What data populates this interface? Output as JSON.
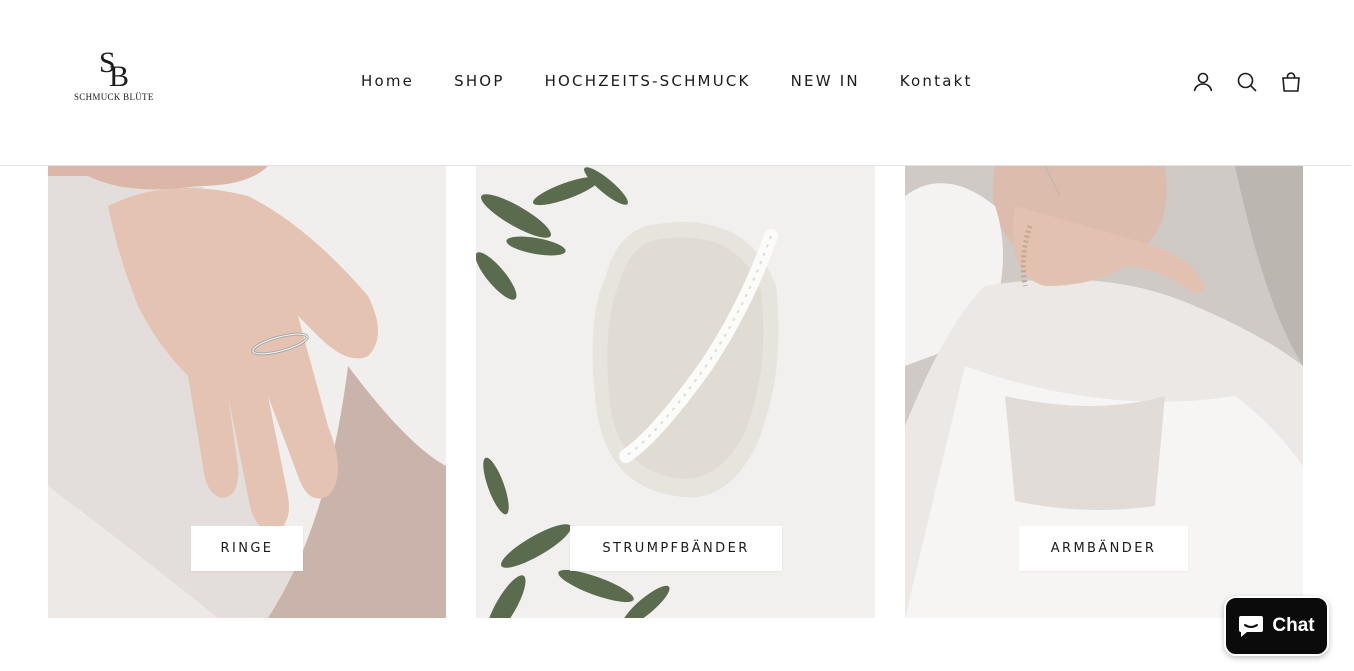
{
  "brand": {
    "name": "SCHMUCK BLÜTE",
    "monogram": "SB"
  },
  "nav": {
    "items": [
      "Home",
      "SHOP",
      "HOCHZEITS-SCHMUCK",
      "NEW IN",
      "Kontakt"
    ]
  },
  "header_icons": [
    "account-icon",
    "search-icon",
    "cart-bag-icon"
  ],
  "collections": [
    {
      "label": "RINGE",
      "image": "hand-with-ring-photo"
    },
    {
      "label": "STRUMPFBÄNDER",
      "image": "lace-garter-on-tray-photo"
    },
    {
      "label": "ARMBÄNDER",
      "image": "bride-with-bracelet-photo"
    }
  ],
  "chat": {
    "label": "Chat",
    "icon": "chat-bubble-icon",
    "background": "#0b0b0b"
  }
}
